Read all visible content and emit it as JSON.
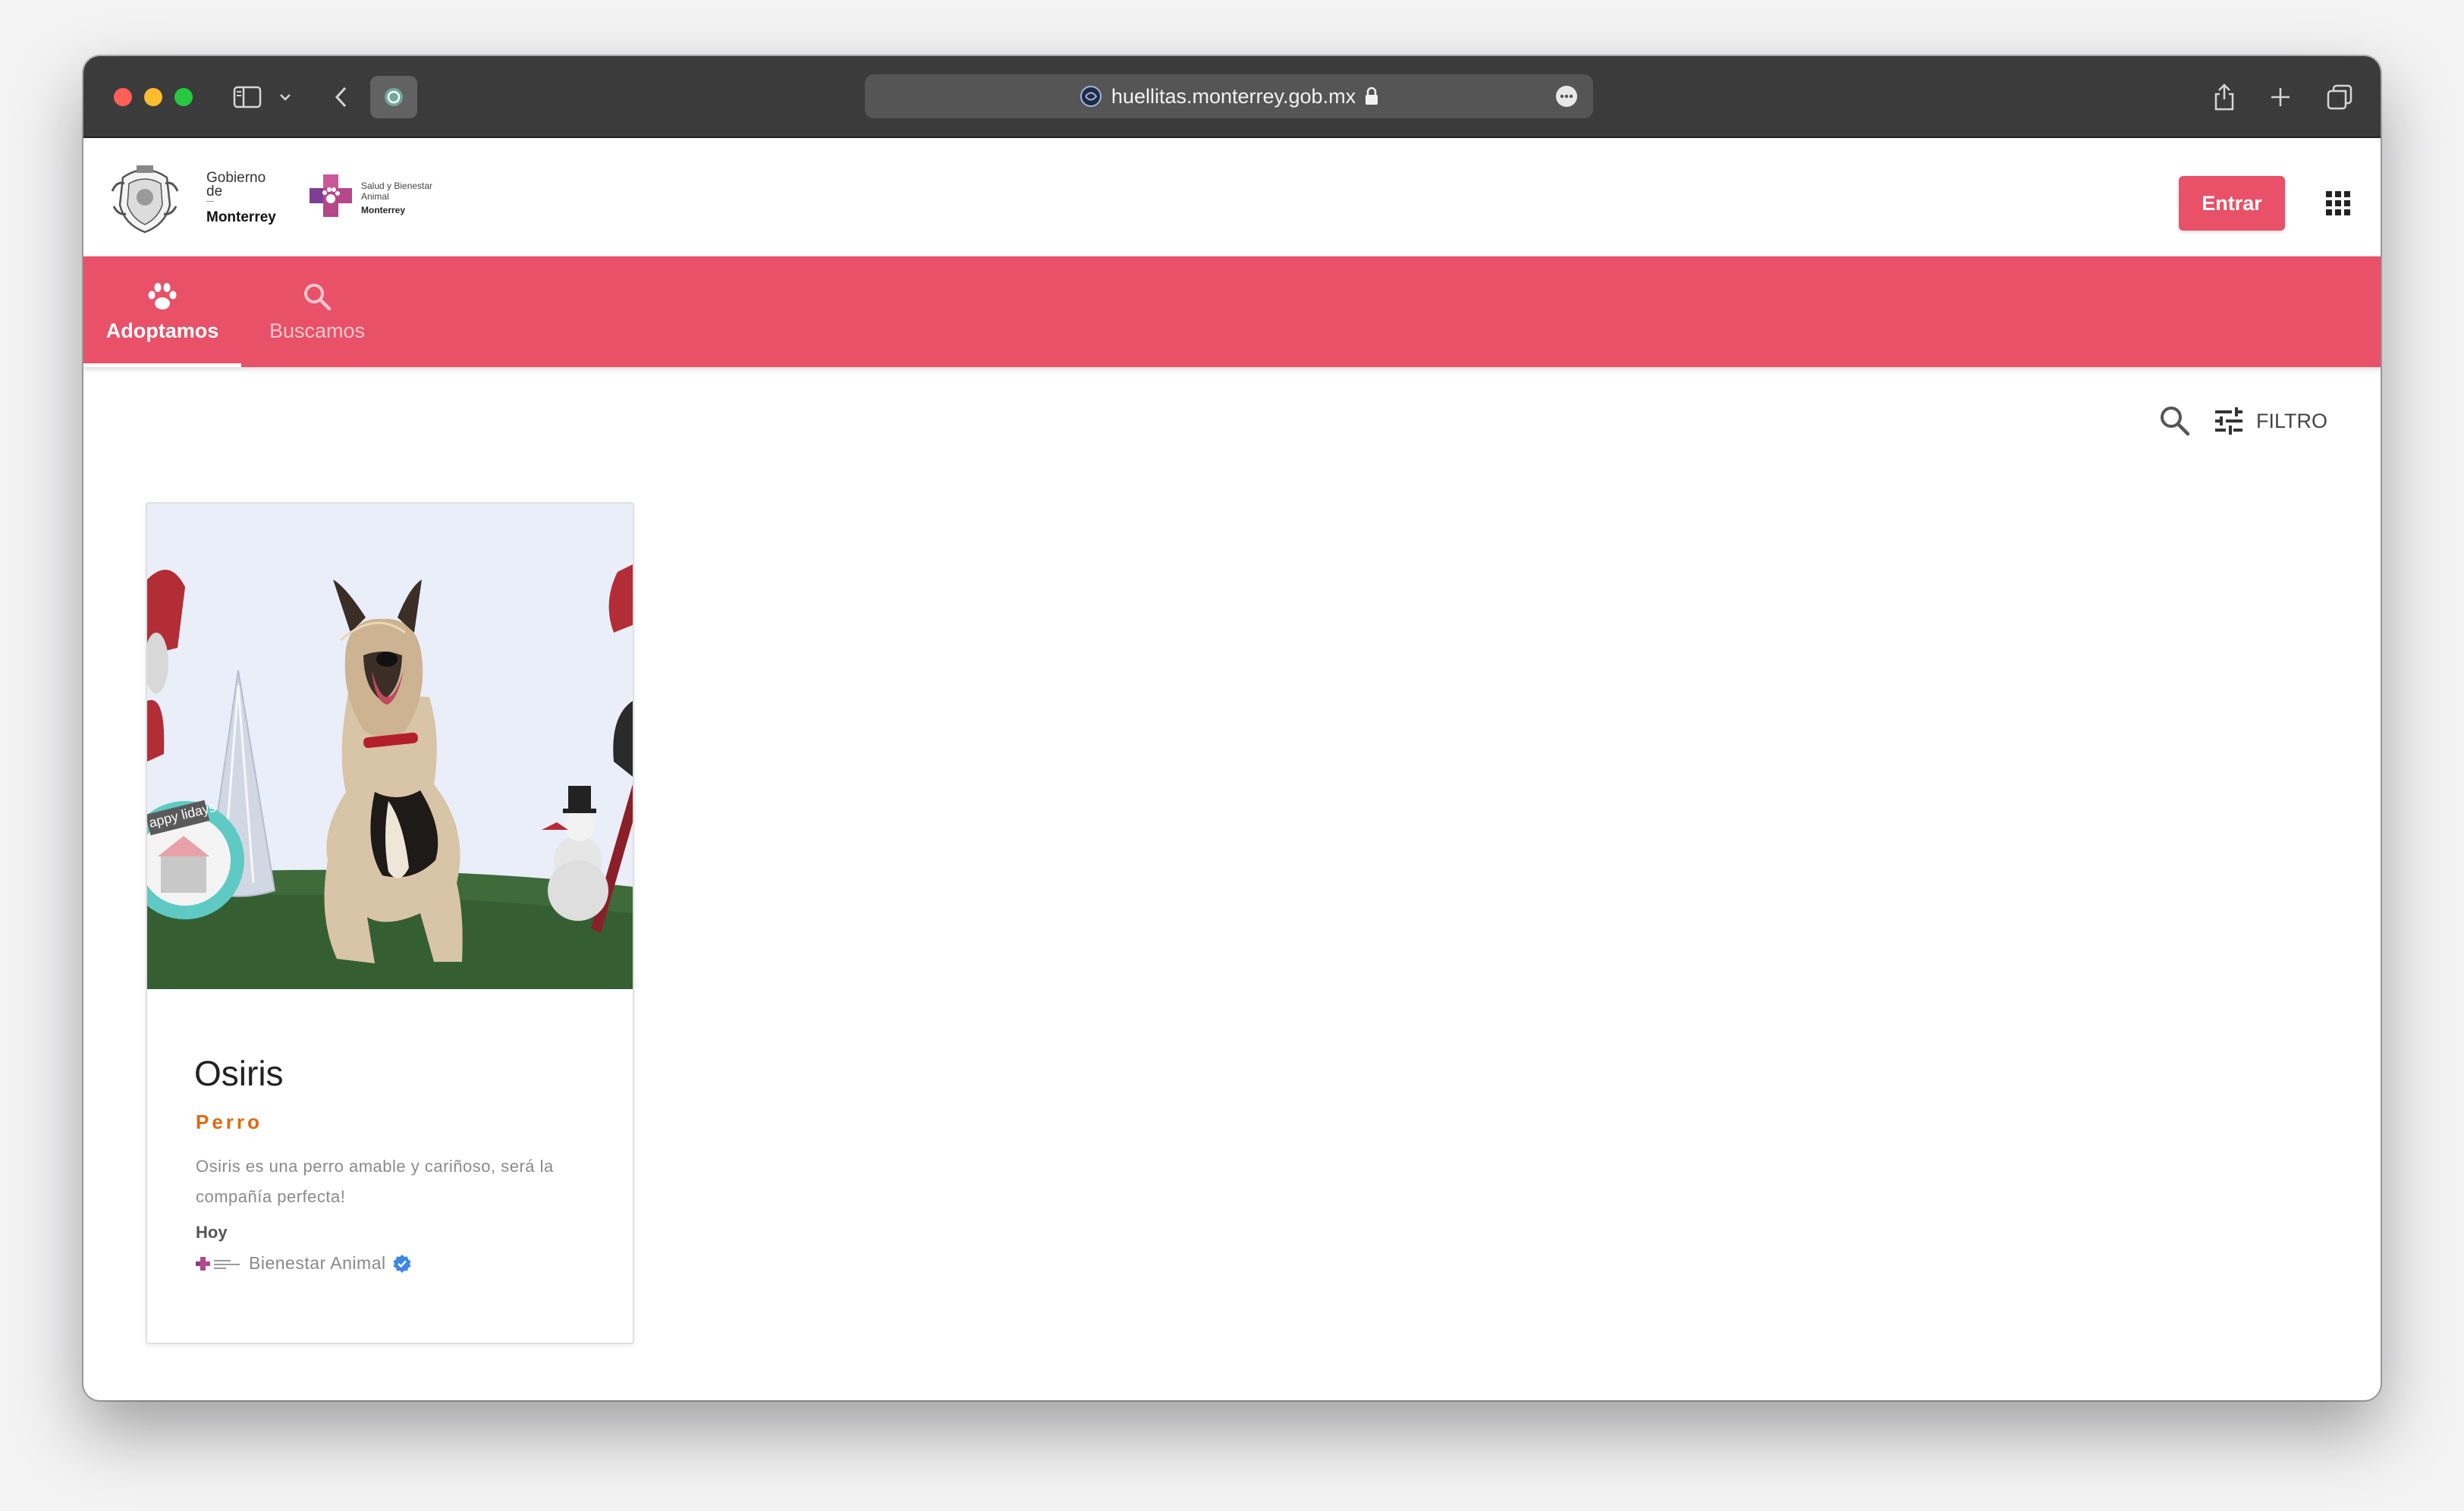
{
  "browser": {
    "url": "huellitas.monterrey.gob.mx"
  },
  "header": {
    "gov_logo_text": [
      "Gobierno",
      "de",
      "Monterrey"
    ],
    "sba_logo_text": [
      "Salud y Bienestar",
      "Animal",
      "Monterrey"
    ],
    "login_label": "Entrar"
  },
  "nav": {
    "tabs": [
      {
        "label": "Adoptamos",
        "icon": "paw-icon",
        "active": true
      },
      {
        "label": "Buscamos",
        "icon": "search-icon",
        "active": false
      }
    ]
  },
  "toolbar": {
    "filter_label": "FILTRO"
  },
  "listing": {
    "cards": [
      {
        "name": "Osiris",
        "type": "Perro",
        "description": "Osiris es una perro amable y cariñoso, será la compañía perfecta!",
        "time": "Hoy",
        "organization": "Bienestar Animal",
        "verified": true,
        "photo_text": "appy lidays"
      }
    ]
  },
  "colors": {
    "brand": "#e85168",
    "type_accent": "#e06a10",
    "titlebar": "#3b3b3b"
  }
}
